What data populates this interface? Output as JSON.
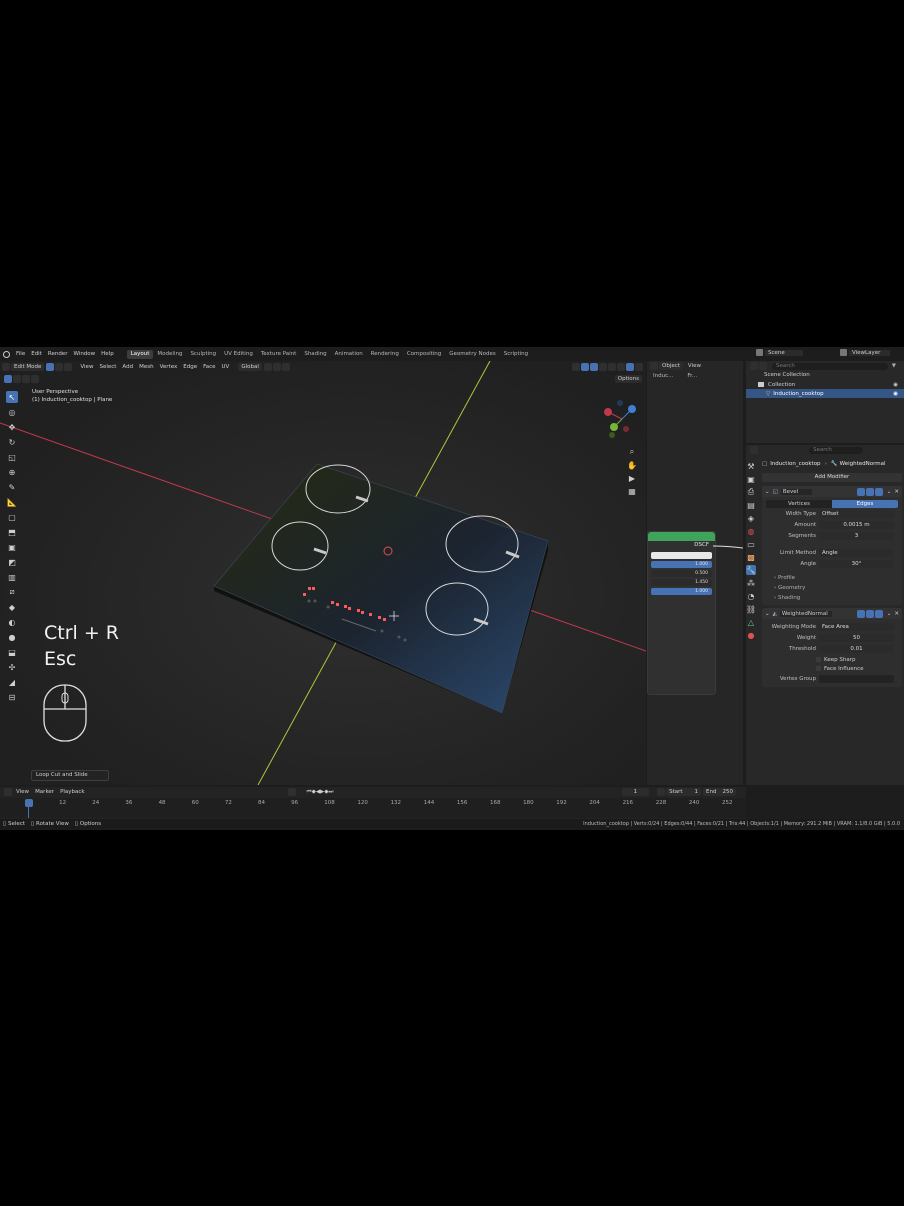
{
  "menu": {
    "items": [
      "File",
      "Edit",
      "Render",
      "Window",
      "Help"
    ],
    "workspaces": [
      "Layout",
      "Modeling",
      "Sculpting",
      "UV Editing",
      "Texture Paint",
      "Shading",
      "Animation",
      "Rendering",
      "Compositing",
      "Geometry Nodes",
      "Scripting"
    ],
    "active_workspace": "Layout",
    "scene": "Scene",
    "view_layer": "ViewLayer"
  },
  "viewport_header": {
    "mode": "Edit Mode",
    "menus": [
      "View",
      "Select",
      "Add",
      "Mesh",
      "Vertex",
      "Edge",
      "Face",
      "UV"
    ],
    "transform_orientation": "Global",
    "options": "Options"
  },
  "viewport": {
    "perspective_label": "User Perspective",
    "object_label": "(1) Induction_cooktop | Plane",
    "overlay_shortcut": "Ctrl + R",
    "overlay_escape": "Esc",
    "last_operator": "Loop Cut and Slide"
  },
  "node_header": {
    "object": "Object",
    "view": "View",
    "crumb": "Induc...",
    "crumb2": "Fr..."
  },
  "node_panel": {
    "label": "DSCF",
    "values": [
      "1.000",
      "0.500",
      "1.450",
      "1.000"
    ]
  },
  "outliner": {
    "search_placeholder": "Search",
    "root": "Scene Collection",
    "collection": "Collection",
    "object": "Induction_cooktop"
  },
  "properties": {
    "search_placeholder": "Search",
    "breadcrumb_object": "Induction_cooktop",
    "breadcrumb_modifier": "WeightedNormal",
    "add_modifier": "Add Modifier",
    "bevel": {
      "name": "Bevel",
      "tab_vertices": "Vertices",
      "tab_edges": "Edges",
      "width_type_label": "Width Type",
      "width_type": "Offset",
      "amount_label": "Amount",
      "amount": "0.0015 m",
      "segments_label": "Segments",
      "segments": "3",
      "limit_method_label": "Limit Method",
      "limit_method": "Angle",
      "angle_label": "Angle",
      "angle": "30°",
      "sub_profile": "Profile",
      "sub_geometry": "Geometry",
      "sub_shading": "Shading"
    },
    "weighted_normal": {
      "name": "WeightedNormal",
      "mode_label": "Weighting Mode",
      "mode": "Face Area",
      "weight_label": "Weight",
      "weight": "50",
      "threshold_label": "Threshold",
      "threshold": "0.01",
      "keep_sharp": "Keep Sharp",
      "face_influence": "Face Influence",
      "vertex_group_label": "Vertex Group"
    }
  },
  "timeline": {
    "menus": [
      "View",
      "Marker",
      "Playback"
    ],
    "current_frame": "1",
    "start_label": "Start",
    "start": "1",
    "end_label": "End",
    "end": "250",
    "ticks": [
      "1",
      "12",
      "24",
      "36",
      "48",
      "60",
      "72",
      "84",
      "96",
      "108",
      "120",
      "132",
      "144",
      "156",
      "168",
      "180",
      "192",
      "204",
      "216",
      "228",
      "240",
      "252"
    ]
  },
  "status_bar": {
    "select": "Select",
    "rotate": "Rotate View",
    "options": "Options",
    "stats": "Induction_cooktop | Verts:0/24 | Edges:0/44 | Faces:0/21 | Tris:44 | Objects:1/1 | Memory: 291.2 MiB | VRAM: 1.1/8.0 GiB | 5.0.0"
  },
  "colors": {
    "accent": "#4772b3",
    "axis_x": "#c0394a",
    "axis_y": "#b8c23a",
    "node_header": "#3fa35a",
    "cooktop_glow": "#ff5a5a"
  }
}
